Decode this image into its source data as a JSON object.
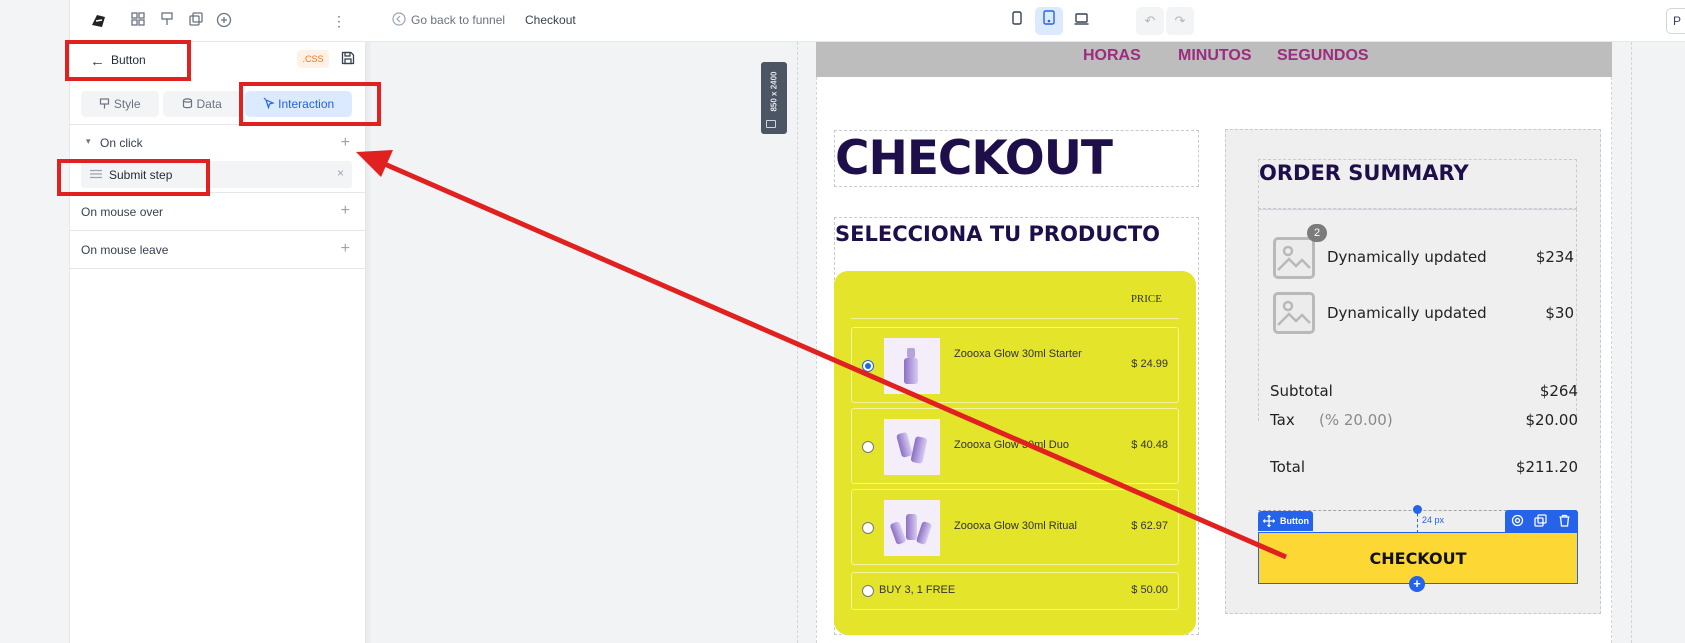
{
  "topbar": {
    "back_label": "Go back to funnel",
    "page_name": "Checkout",
    "right_cut_label": "P"
  },
  "panel": {
    "title": "Button",
    "css_badge": ".CSS",
    "tabs": [
      {
        "label": "Style",
        "icon": "brush-icon"
      },
      {
        "label": "Data",
        "icon": "database-icon"
      },
      {
        "label": "Interaction",
        "icon": "pointer-icon",
        "active": true
      }
    ],
    "on_click_label": "On click",
    "action_label": "Submit step",
    "mouse_over_label": "On mouse over",
    "mouse_leave_label": "On mouse leave"
  },
  "canvas": {
    "size_badge": "850 x 2400",
    "timer_labels": [
      "HORAS",
      "MINUTOS",
      "SEGUNDOS"
    ],
    "checkout_heading": "CHECKOUT",
    "select_heading": "SELECCIONA TU PRODUCTO",
    "price_header": "PRICE",
    "products": [
      {
        "name": "Zoooxa Glow 30ml Starter",
        "price": "$ 24.99",
        "selected": true
      },
      {
        "name": "Zoooxa Glow 30ml Duo",
        "price": "$ 40.48",
        "selected": false
      },
      {
        "name": "Zoooxa Glow 30ml Ritual",
        "price": "$ 62.97",
        "selected": false
      }
    ],
    "bundle": {
      "name": "BUY 3, 1 FREE",
      "price": "$ 50.00"
    },
    "summary": {
      "title": "ORDER SUMMARY",
      "badge_count": "2",
      "items": [
        {
          "name": "Dynamically updated",
          "price": "$234"
        },
        {
          "name": "Dynamically updated",
          "price": "$30"
        }
      ],
      "subtotal_label": "Subtotal",
      "subtotal_value": "$264",
      "tax_label": "Tax",
      "tax_rate": "(% 20.00)",
      "tax_value": "$20.00",
      "total_label": "Total",
      "total_value": "$211.20"
    },
    "button_tag": "Button",
    "spacing_label": "24 px",
    "checkout_button": "CHECKOUT"
  },
  "colors": {
    "accent": "#2563eb",
    "annotation_red": "#e12020",
    "product_card": "#e4e42b",
    "checkout_button": "#fdd835",
    "timer_text": "#9b2c80",
    "heading": "#1e0f4b"
  }
}
